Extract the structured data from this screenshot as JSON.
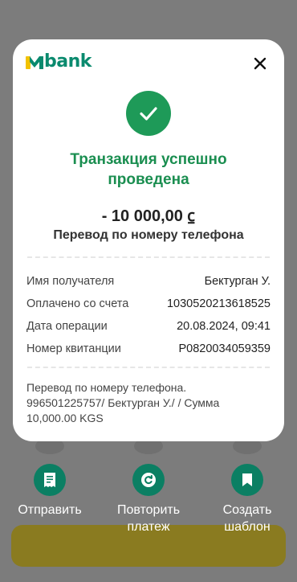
{
  "brand": {
    "logo_text": "bank",
    "color": "#0a8a6e",
    "accent": "#f2c200"
  },
  "close_icon": "close-icon",
  "status": {
    "icon": "checkmark-icon",
    "title_line1": "Транзакция успешно",
    "title_line2": "проведена",
    "color": "#1a8e50"
  },
  "amount": "- 10 000,00 ⃀",
  "subtitle": "Перевод по номеру телефона",
  "details": [
    {
      "label": "Имя получателя",
      "value": "Бектурган У."
    },
    {
      "label": "Оплачено со счета",
      "value": "1030520213618525"
    },
    {
      "label": "Дата операции",
      "value": "20.08.2024, 09:41"
    },
    {
      "label": "Номер квитанции",
      "value": "P0820034059359"
    }
  ],
  "note": {
    "line1": "Перевод по номеру телефона.",
    "line2": "996501225757/ Бектурган У./ / Сумма",
    "line3": "10,000.00 KGS"
  },
  "actions": [
    {
      "icon": "receipt-icon",
      "label_line1": "Отправить",
      "label_line2": ""
    },
    {
      "icon": "repeat-icon",
      "label_line1": "Повторить",
      "label_line2": "платеж"
    },
    {
      "icon": "bookmark-icon",
      "label_line1": "Создать",
      "label_line2": "шаблон"
    }
  ]
}
